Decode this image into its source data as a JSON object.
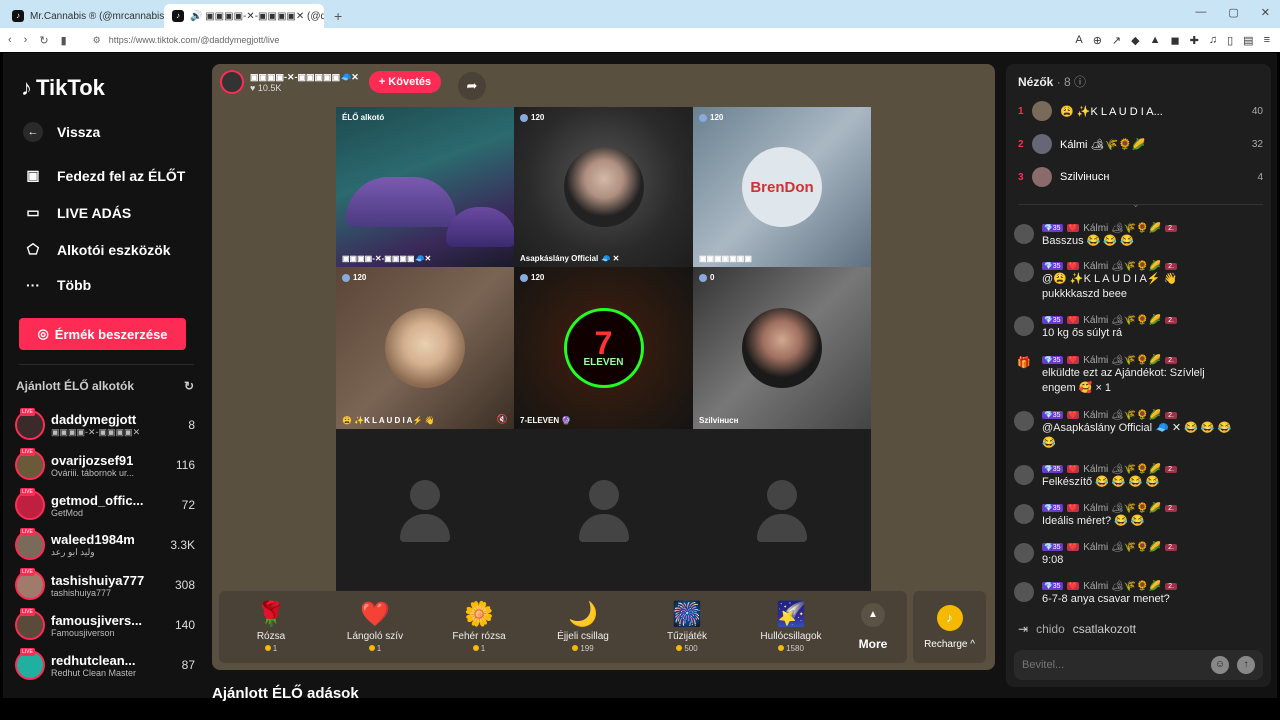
{
  "browser": {
    "tabs": [
      {
        "title": "Mr.Cannabis ® (@mrcannabis )",
        "active": false
      },
      {
        "title": "🔊 ▣▣▣▣-✕-▣▣▣▣✕ (@da",
        "active": true
      }
    ],
    "new_tab": "+",
    "url": "https://www.tiktok.com/@daddymegjott/live"
  },
  "sidebar": {
    "logo": "TikTok",
    "back": "Vissza",
    "nav": [
      {
        "label": "Fedezd fel az ÉLŐT",
        "icon": "live-feed-icon"
      },
      {
        "label": "LIVE ADÁS",
        "icon": "video-camera-icon"
      },
      {
        "label": "Alkotói eszközök",
        "icon": "creator-tools-icon"
      },
      {
        "label": "Több",
        "icon": "more-dots-icon"
      }
    ],
    "coins_button": "Érmék beszerzése",
    "recommended_title": "Ajánlott ÉLŐ alkotók",
    "creators": [
      {
        "name": "daddymegjott",
        "sub": "▣▣▣▣-✕-▣▣▣▣✕",
        "count": "8"
      },
      {
        "name": "ovarijozsef91",
        "sub": "Ováriii. tábornok ur...",
        "count": "116"
      },
      {
        "name": "getmod_offic...",
        "sub": "GetMod",
        "count": "72"
      },
      {
        "name": "waleed1984m",
        "sub": "وليد ابو رعد",
        "count": "3.3K"
      },
      {
        "name": "tashishuiya777",
        "sub": "tashishuiya777",
        "count": "308"
      },
      {
        "name": "famousjivers...",
        "sub": "Famousjiverson",
        "count": "140"
      },
      {
        "name": "redhutclean...",
        "sub": "Redhut Clean Master",
        "count": "87"
      }
    ],
    "live_badge": "LIVE"
  },
  "stream": {
    "host_name": "▣▣▣▣-✕-▣▣▣▣▣🧢✕",
    "likes": "♥ 10.5K",
    "follow": "+ Követés",
    "cells": [
      {
        "badge": "ÉLŐ alkotó",
        "label": "▣▣▣▣-✕-▣▣▣▣🧢✕"
      },
      {
        "badge": "120",
        "label": "Asapkáslány Official 🧢 ✕"
      },
      {
        "badge": "120",
        "label": "▣▣▣▣▣▣▣",
        "avatar_text": "BrenDon"
      },
      {
        "badge": "120",
        "label": "😩 ✨K L A U D I A⚡ 👋"
      },
      {
        "badge": "120",
        "label": "7-ELEVEN 🔮",
        "avatar_text": "7",
        "avatar_sub": "ELEVEN"
      },
      {
        "badge": "0",
        "label": "Szilviнucн"
      }
    ],
    "gifts": [
      {
        "name": "Rózsa",
        "price": "1",
        "icon": "🌹"
      },
      {
        "name": "Lángoló szív",
        "price": "1",
        "icon": "❤️"
      },
      {
        "name": "Fehér rózsa",
        "price": "1",
        "icon": "🌼"
      },
      {
        "name": "Éjjeli csillag",
        "price": "199",
        "icon": "🌙"
      },
      {
        "name": "Tűzijáték",
        "price": "500",
        "icon": "🎆"
      },
      {
        "name": "Hullócsillagok",
        "price": "1580",
        "icon": "🌠"
      }
    ],
    "more": "More",
    "recharge": "Recharge ^"
  },
  "recommended_streams": "Ajánlott ÉLŐ adások",
  "chat": {
    "viewers_title": "Nézők",
    "viewers_count": "· 8",
    "top_viewers": [
      {
        "rank": "1",
        "name": "😩 ✨K L A U D I A...",
        "score": "40"
      },
      {
        "rank": "2",
        "name": "Kálmi 🏕🌾🌻🌽",
        "score": "32"
      },
      {
        "rank": "3",
        "name": "Szilviнucн",
        "score": "4"
      }
    ],
    "badges": {
      "level": "💎35",
      "fan": "❤️",
      "fan_level": "2."
    },
    "messages": [
      {
        "user": "Kálmi 🏕🌾🌻🌽",
        "text": "Basszus 😂 😂 😂",
        "icon": "avatar"
      },
      {
        "user": "Kálmi 🏕🌾🌻🌽",
        "text": "@😩 ✨K L A U D I A⚡ 👋 pukkkkaszd beee",
        "icon": "avatar"
      },
      {
        "user": "Kálmi 🏕🌾🌻🌽",
        "text": "10 kg ős súlyt rá",
        "icon": "avatar"
      },
      {
        "user": "Kálmi 🏕🌾🌻🌽",
        "text": "elküldte ezt az Ajándékot: Szívlelj engem 🥰 × 1",
        "icon": "gift"
      },
      {
        "user": "Kálmi 🏕🌾🌻🌽",
        "text": "@Asapkáslány Official 🧢 ✕ 😂 😂 😂 😂",
        "icon": "avatar"
      },
      {
        "user": "Kálmi 🏕🌾🌻🌽",
        "text": "Felkészítő 😂 😂 😂 😂",
        "icon": "avatar"
      },
      {
        "user": "Kálmi 🏕🌾🌻🌽",
        "text": "Ideális méret? 😂 😂",
        "icon": "avatar"
      },
      {
        "user": "Kálmi 🏕🌾🌻🌽",
        "text": "9:08",
        "icon": "avatar"
      },
      {
        "user": "Kálmi 🏕🌾🌻🌽",
        "text": "6-7-8 anya csavar menet?",
        "icon": "avatar"
      }
    ],
    "join_user": "chido",
    "join_text": "csatlakozott",
    "input_placeholder": "Bevitel..."
  }
}
